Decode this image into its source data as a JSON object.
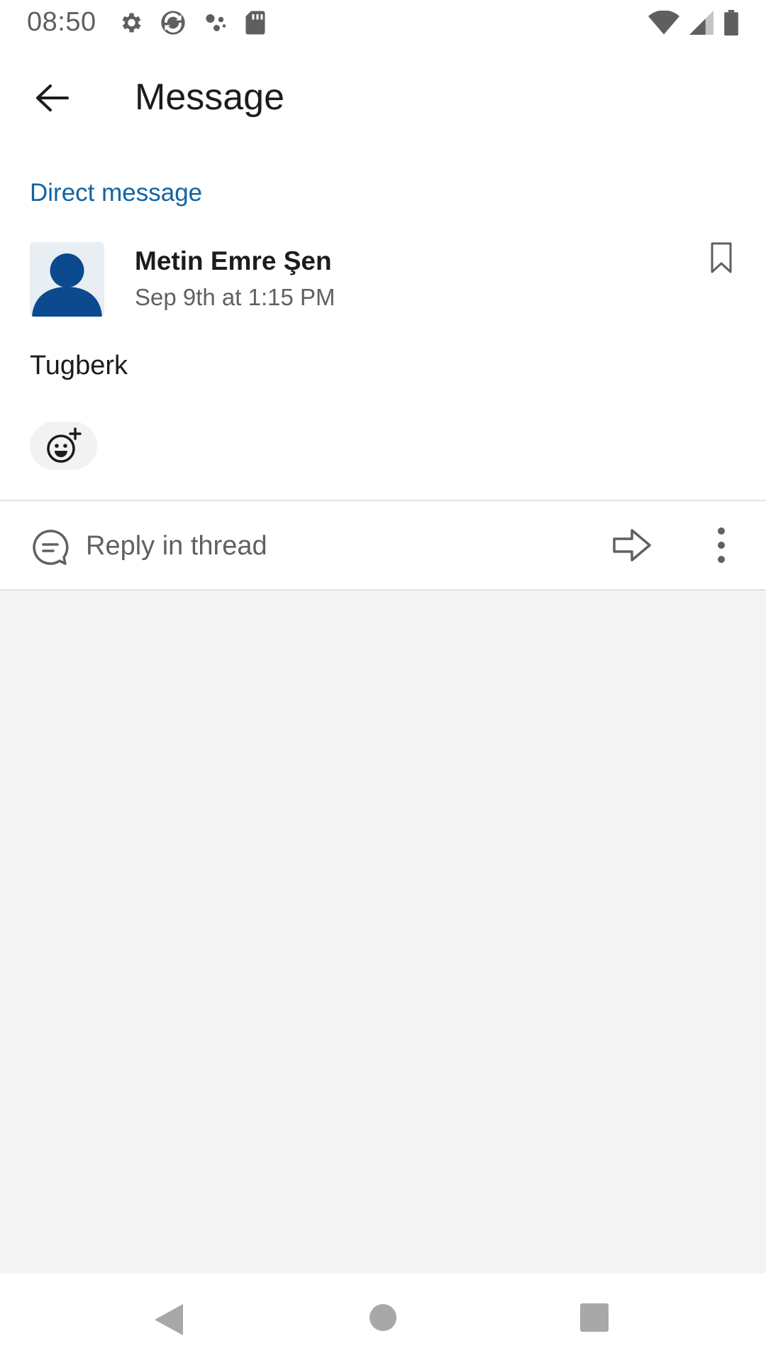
{
  "status_bar": {
    "time": "08:50",
    "left_icons": [
      "gear-icon",
      "sync-icon",
      "assistant-dots-icon",
      "sd-card-icon"
    ],
    "right_icons": [
      "wifi-icon",
      "cell-signal-icon",
      "battery-icon"
    ]
  },
  "app_bar": {
    "title": "Message"
  },
  "message": {
    "channel_label": "Direct message",
    "sender": "Metin Emre Şen",
    "timestamp": "Sep 9th at 1:15 PM",
    "text": "Tugberk"
  },
  "actions": {
    "reply_label": "Reply in thread"
  },
  "colors": {
    "link_blue": "#1264a3",
    "avatar_blue": "#0b4a8f",
    "empty_background": "#f4f4f4"
  }
}
